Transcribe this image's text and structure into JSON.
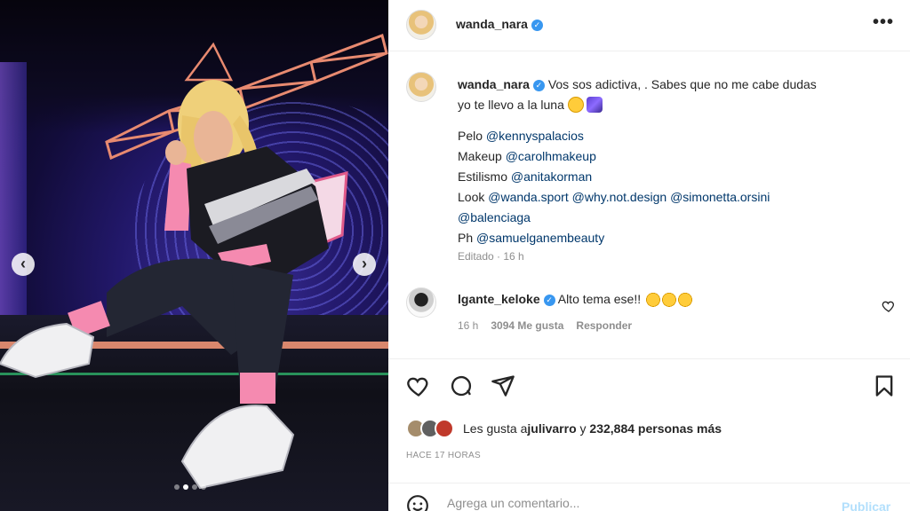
{
  "post": {
    "author": "wanda_nara",
    "more_glyph": "•••",
    "verified_glyph": "✓",
    "carousel": {
      "prev_glyph": "‹",
      "next_glyph": "›",
      "slides": 4,
      "active": 1
    }
  },
  "caption": {
    "username": "wanda_nara",
    "text_line1": "Vos sos adictiva, . Sabes que no me cabe dudas",
    "text_line2": "yo te llevo a la luna",
    "credits": [
      {
        "label": "Pelo ",
        "mentions": [
          "@kennyspalacios"
        ]
      },
      {
        "label": "Makeup ",
        "mentions": [
          "@carolhmakeup"
        ]
      },
      {
        "label": "Estilismo ",
        "mentions": [
          "@anitakorman"
        ]
      },
      {
        "label": "Look ",
        "mentions": [
          "@wanda.sport",
          "@why.not.design",
          "@simonetta.orsini"
        ]
      },
      {
        "label": "",
        "mentions": [
          "@balenciaga"
        ]
      },
      {
        "label": "Ph ",
        "mentions": [
          "@samuelganembeauty"
        ]
      }
    ],
    "meta": "Editado · 16 h"
  },
  "comment": {
    "username": "lgante_keloke",
    "text": "Alto tema ese!!",
    "time": "16 h",
    "likes": "3094 Me gusta",
    "reply": "Responder"
  },
  "likes": {
    "prefix": "Les gusta a ",
    "user": "julivarro",
    "middle": " y ",
    "count": "232,884 personas más"
  },
  "timestamp": "HACE 17 HORAS",
  "comment_input": {
    "placeholder": "Agrega un comentario...",
    "publish": "Publicar"
  },
  "colors": {
    "verified": "#3897f0",
    "mention": "#00376b",
    "muted": "#8e8e8e",
    "publish_disabled": "#b2dffc"
  },
  "icons": [
    "heart-icon",
    "comment-icon",
    "share-icon",
    "bookmark-icon",
    "emoji-icon",
    "more-icon"
  ]
}
